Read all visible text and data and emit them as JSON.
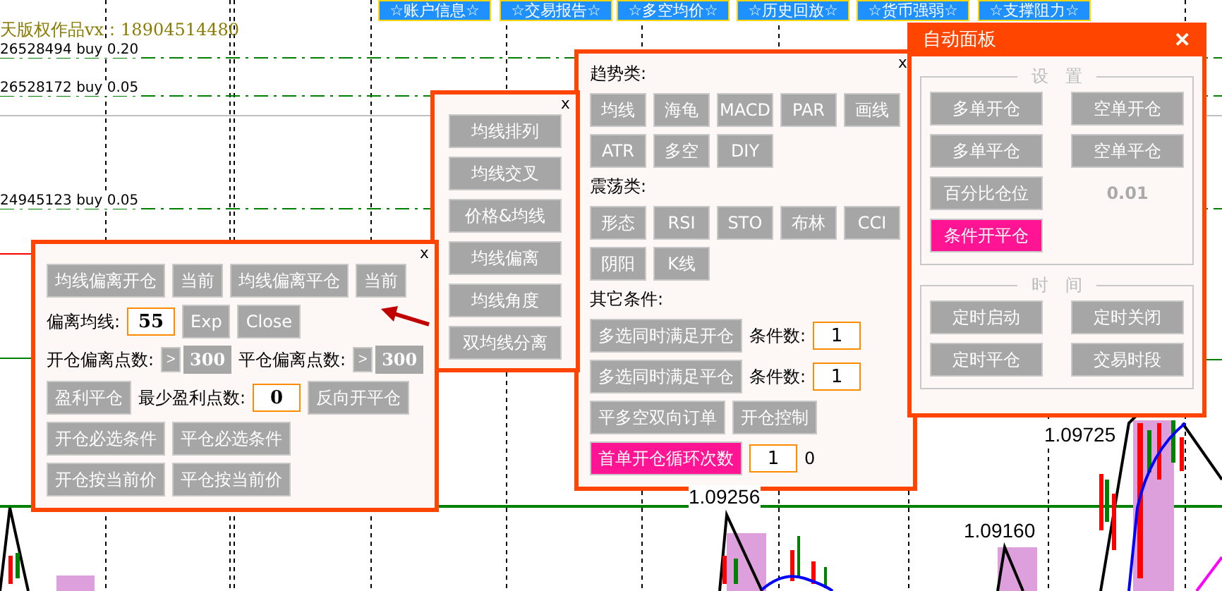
{
  "top_buttons": [
    {
      "label": "☆账户信息☆"
    },
    {
      "label": "☆交易报告☆"
    },
    {
      "label": "☆多空均价☆"
    },
    {
      "label": "☆历史回放☆"
    },
    {
      "label": "☆货币强弱☆"
    },
    {
      "label": "☆支撑阻力☆"
    }
  ],
  "copyright_text": "天版权作品vx：18904514480",
  "order_lines": [
    {
      "label": "26528494 buy 0.20"
    },
    {
      "label": "26528172 buy 0.05"
    },
    {
      "label": "24945123 buy 0.05"
    }
  ],
  "price_labels": [
    "1.09256",
    "1.09160",
    "1.09725"
  ],
  "ma_panel": {
    "close": "x",
    "buttons": [
      "均线排列",
      "均线交叉",
      "价格&均线",
      "均线偏离",
      "均线角度",
      "双均线分离"
    ]
  },
  "deviation_panel": {
    "close": "x",
    "rows": [
      {
        "items": [
          {
            "kind": "button",
            "label": "均线偏离开仓"
          },
          {
            "kind": "button",
            "label": "当前"
          },
          {
            "kind": "button",
            "label": "均线偏离平仓"
          },
          {
            "kind": "button",
            "label": "当前"
          }
        ]
      },
      {
        "items": [
          {
            "kind": "label",
            "label": "偏离均线:"
          },
          {
            "kind": "field",
            "label": "55"
          },
          {
            "kind": "button",
            "label": "Exp"
          },
          {
            "kind": "button",
            "label": "Close"
          }
        ]
      },
      {
        "items": [
          {
            "kind": "label",
            "label": "开仓偏离点数:"
          },
          {
            "kind": "arrow",
            "label": ">"
          },
          {
            "kind": "valuebox",
            "label": "300"
          },
          {
            "kind": "label",
            "label": "平仓偏离点数:"
          },
          {
            "kind": "arrow",
            "label": ">"
          },
          {
            "kind": "valuebox",
            "label": "300"
          }
        ]
      },
      {
        "items": [
          {
            "kind": "button",
            "label": "盈利平仓"
          },
          {
            "kind": "label",
            "label": "最少盈利点数:"
          },
          {
            "kind": "field",
            "label": "0"
          },
          {
            "kind": "button",
            "label": "反向开平仓"
          }
        ]
      },
      {
        "items": [
          {
            "kind": "button",
            "label": "开仓必选条件"
          },
          {
            "kind": "button",
            "label": "平仓必选条件"
          }
        ]
      },
      {
        "items": [
          {
            "kind": "button",
            "label": "开仓按当前价"
          },
          {
            "kind": "button",
            "label": "平仓按当前价"
          }
        ]
      }
    ]
  },
  "condition_panel": {
    "close": "x",
    "sections": [
      {
        "heading": "趋势类:",
        "buttons": [
          "均线",
          "海龟",
          "MACD",
          "PAR",
          "画线",
          "ATR",
          "多空",
          "DIY"
        ]
      },
      {
        "heading": "震荡类:",
        "buttons": [
          "形态",
          "RSI",
          "STO",
          "布林",
          "CCI",
          "阴阳",
          "K线"
        ]
      }
    ],
    "others": {
      "heading": "其它条件:",
      "rows": [
        {
          "items": [
            {
              "kind": "button",
              "label": "多选同时满足开仓",
              "active": false
            },
            {
              "kind": "label",
              "label": "条件数:"
            },
            {
              "kind": "field",
              "label": "1"
            }
          ]
        },
        {
          "items": [
            {
              "kind": "button",
              "label": "多选同时满足平仓",
              "active": false
            },
            {
              "kind": "label",
              "label": "条件数:"
            },
            {
              "kind": "field",
              "label": "1"
            }
          ]
        },
        {
          "items": [
            {
              "kind": "button",
              "label": "平多空双向订单",
              "active": false
            },
            {
              "kind": "button",
              "label": "开仓控制",
              "active": false
            }
          ]
        },
        {
          "items": [
            {
              "kind": "button",
              "label": "首单开仓循环次数",
              "active": true
            },
            {
              "kind": "field",
              "label": "1"
            },
            {
              "kind": "text",
              "label": "0"
            }
          ]
        }
      ]
    }
  },
  "auto_panel": {
    "title": "自动面板",
    "close": "✕",
    "settings": {
      "legend": "设　置",
      "items": [
        {
          "kind": "button",
          "label": "多单开仓",
          "active": false
        },
        {
          "kind": "button",
          "label": "空单开仓",
          "active": false
        },
        {
          "kind": "button",
          "label": "多单平仓",
          "active": false
        },
        {
          "kind": "button",
          "label": "空单平仓",
          "active": false
        },
        {
          "kind": "button",
          "label": "百分比仓位",
          "active": false
        },
        {
          "kind": "value",
          "label": "0.01"
        },
        {
          "kind": "button",
          "label": "条件开平仓",
          "active": true
        }
      ]
    },
    "time": {
      "legend": "时　间",
      "buttons": [
        "定时启动",
        "定时关闭",
        "定时平仓",
        "交易时段"
      ]
    }
  }
}
